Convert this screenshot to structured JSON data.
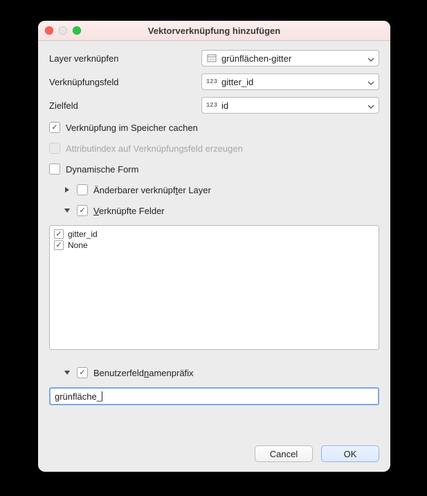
{
  "window": {
    "title": "Vektorverknüpfung hinzufügen"
  },
  "form": {
    "join_layer_label": "Layer verknüpfen",
    "join_layer_value": "grünflächen-gitter",
    "join_field_label": "Verknüpfungsfeld",
    "join_field_value": "gitter_id",
    "target_field_label": "Zielfeld",
    "target_field_value": "id",
    "cache_label": "Verknüpfung im Speicher cachen",
    "cache_checked": true,
    "index_label": "Attributindex auf Verknüpfungsfeld erzeugen",
    "index_enabled": false,
    "dyn_form_label": "Dynamische Form",
    "dyn_form_checked": false,
    "editable_layer_pre": "Änderbarer verknüpf",
    "editable_layer_ul": "t",
    "editable_layer_post": "er Layer",
    "editable_layer_checked": false,
    "editable_layer_expanded": false,
    "joined_fields_ul": "V",
    "joined_fields_post": "erknüpfte Felder",
    "joined_fields_checked": true,
    "joined_fields_expanded": true,
    "fields": [
      {
        "name": "gitter_id",
        "checked": true
      },
      {
        "name": "None",
        "checked": true
      }
    ],
    "prefix_pre": "Benutzerfeld",
    "prefix_ul": "n",
    "prefix_post": "amenpräfix",
    "prefix_checked": true,
    "prefix_expanded": true,
    "prefix_value": "grünfläche_"
  },
  "buttons": {
    "cancel": "Cancel",
    "ok": "OK"
  }
}
